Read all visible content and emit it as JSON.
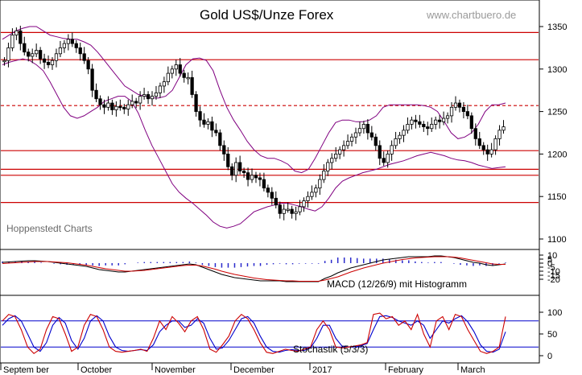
{
  "header": {
    "title": "Gold US$/Unze Forex",
    "site": "www.chartbuero.de"
  },
  "watermark": "Hoppenstedt Charts",
  "colors": {
    "price": "#000000",
    "band": "#800080",
    "resistance": "#cc0000",
    "macd_line": "#000000",
    "macd_signal": "#cc0000",
    "macd_hist": "#2a2acc",
    "stoch_k": "#cc0000",
    "stoch_d": "#0000cc",
    "stoch_levels": "#0000cc"
  },
  "chart_data": [
    {
      "type": "candlestick",
      "title": "Gold US$/Unze Forex",
      "ylim": [
        1100,
        1365
      ],
      "y_ticks": [
        "1100",
        "1150",
        "1200",
        "1250",
        "1300",
        "1350"
      ],
      "x_labels": [
        "Septem ber",
        "October",
        "November",
        "December",
        "2017",
        "February",
        "March"
      ],
      "close": [
        1310,
        1325,
        1340,
        1345,
        1330,
        1320,
        1315,
        1318,
        1322,
        1312,
        1308,
        1305,
        1310,
        1318,
        1325,
        1330,
        1335,
        1330,
        1325,
        1318,
        1310,
        1300,
        1275,
        1265,
        1258,
        1255,
        1260,
        1252,
        1256,
        1255,
        1253,
        1258,
        1262,
        1260,
        1268,
        1270,
        1265,
        1268,
        1272,
        1280,
        1285,
        1295,
        1300,
        1305,
        1295,
        1290,
        1290,
        1270,
        1250,
        1240,
        1235,
        1238,
        1228,
        1225,
        1210,
        1200,
        1185,
        1175,
        1190,
        1180,
        1178,
        1170,
        1175,
        1172,
        1170,
        1160,
        1155,
        1148,
        1140,
        1130,
        1135,
        1135,
        1130,
        1132,
        1138,
        1145,
        1150,
        1155,
        1160,
        1170,
        1180,
        1190,
        1195,
        1200,
        1205,
        1210,
        1215,
        1220,
        1225,
        1230,
        1235,
        1225,
        1220,
        1210,
        1195,
        1190,
        1200,
        1210,
        1218,
        1222,
        1228,
        1235,
        1240,
        1238,
        1235,
        1232,
        1230,
        1235,
        1240,
        1238,
        1242,
        1245,
        1255,
        1260,
        1255,
        1250,
        1245,
        1230,
        1218,
        1210,
        1205,
        1200,
        1205,
        1218,
        1228,
        1232
      ],
      "bollinger_upper": [
        1335,
        1340,
        1345,
        1348,
        1350,
        1350,
        1345,
        1340,
        1338,
        1336,
        1335,
        1335,
        1332,
        1328,
        1320,
        1310,
        1300,
        1290,
        1280,
        1275,
        1270,
        1268,
        1266,
        1266,
        1268,
        1275,
        1290,
        1305,
        1312,
        1313,
        1310,
        1298,
        1275,
        1255,
        1240,
        1228,
        1215,
        1205,
        1198,
        1195,
        1195,
        1192,
        1188,
        1180,
        1178,
        1182,
        1195,
        1210,
        1225,
        1237,
        1240,
        1240,
        1238,
        1238,
        1240,
        1245,
        1255,
        1258,
        1258,
        1258,
        1258,
        1258,
        1257,
        1255,
        1250,
        1238,
        1225,
        1218,
        1220,
        1225,
        1235,
        1250,
        1258,
        1258,
        1260
      ],
      "bollinger_lower": [
        1305,
        1308,
        1310,
        1312,
        1310,
        1305,
        1298,
        1285,
        1270,
        1255,
        1245,
        1242,
        1245,
        1250,
        1255,
        1262,
        1265,
        1268,
        1268,
        1262,
        1248,
        1228,
        1210,
        1195,
        1180,
        1165,
        1155,
        1148,
        1142,
        1135,
        1128,
        1120,
        1115,
        1113,
        1115,
        1118,
        1125,
        1132,
        1135,
        1138,
        1140,
        1142,
        1142,
        1140,
        1138,
        1135,
        1133,
        1138,
        1148,
        1160,
        1168,
        1172,
        1175,
        1178,
        1180,
        1182,
        1185,
        1188,
        1190,
        1192,
        1195,
        1198,
        1200,
        1202,
        1200,
        1198,
        1195,
        1193,
        1192,
        1190,
        1187,
        1185,
        1183,
        1184,
        1185
      ],
      "resistance_lines": [
        1343,
        1311,
        1257,
        1204,
        1182,
        1175,
        1143
      ],
      "resistance_styles": [
        "solid",
        "solid",
        "dashed",
        "solid",
        "solid",
        "solid",
        "solid"
      ]
    },
    {
      "type": "macd",
      "name": "MACD (12/26/9) mit Histogramm",
      "ylim": [
        -24,
        14
      ],
      "y_ticks": [
        "10",
        "5",
        "0",
        "-5",
        "-10",
        "-15",
        "-20"
      ],
      "macd": [
        1,
        1.5,
        2,
        2.5,
        3,
        3,
        2.5,
        2,
        1,
        0,
        -1,
        -2,
        -3,
        -4,
        -6,
        -8,
        -9,
        -10,
        -11,
        -11,
        -10,
        -9,
        -8,
        -7,
        -6,
        -5,
        -4,
        -3,
        -2,
        -1,
        -2,
        -5,
        -8,
        -11,
        -14,
        -16,
        -18,
        -19,
        -20,
        -21,
        -22,
        -22,
        -22,
        -22,
        -23,
        -23,
        -23,
        -23,
        -23,
        -23,
        -19,
        -16,
        -12,
        -9,
        -6,
        -4,
        -2,
        0,
        2,
        4,
        5,
        6,
        7,
        8,
        8,
        8,
        8,
        9,
        9,
        8,
        7,
        5,
        3,
        1,
        0,
        -2,
        -3,
        -2,
        -1
      ],
      "signal": [
        -0.5,
        0,
        0.5,
        1,
        1.5,
        2,
        2,
        2,
        1.5,
        1,
        0.5,
        -0.5,
        -1.5,
        -2.5,
        -4,
        -5.5,
        -7,
        -8,
        -9,
        -10,
        -10,
        -9.5,
        -9,
        -8,
        -7,
        -6,
        -5,
        -4,
        -3,
        -2.5,
        -2.5,
        -3.5,
        -5.5,
        -7.5,
        -10,
        -12,
        -14,
        -15.5,
        -17,
        -18.5,
        -19.5,
        -20.5,
        -21,
        -21.5,
        -22,
        -22,
        -22.5,
        -22.5,
        -22.5,
        -22.5,
        -21,
        -19,
        -17,
        -14,
        -11,
        -8.5,
        -6,
        -4,
        -2,
        0,
        1.5,
        3,
        4.5,
        5.5,
        6.5,
        7,
        7.5,
        8,
        8,
        8,
        7.5,
        6.5,
        5,
        3.5,
        2,
        0.5,
        -1,
        -1.5,
        -1.5
      ]
    },
    {
      "type": "stochastic",
      "name": "Stochastik (5/3/3)",
      "ylim": [
        0,
        100
      ],
      "y_ticks": [
        "100",
        "50",
        "0"
      ],
      "levels": [
        80,
        20
      ],
      "k": [
        80,
        95,
        90,
        60,
        20,
        5,
        15,
        60,
        90,
        85,
        50,
        10,
        20,
        70,
        95,
        90,
        60,
        20,
        10,
        8,
        10,
        12,
        15,
        10,
        40,
        80,
        60,
        90,
        75,
        55,
        80,
        90,
        60,
        15,
        8,
        25,
        45,
        80,
        95,
        85,
        60,
        30,
        8,
        5,
        10,
        15,
        12,
        10,
        15,
        20,
        60,
        80,
        60,
        20,
        18,
        20,
        22,
        25,
        30,
        95,
        98,
        85,
        90,
        70,
        80,
        60,
        95,
        50,
        20,
        80,
        90,
        60,
        95,
        90,
        60,
        35,
        10,
        5,
        10,
        20,
        90
      ],
      "d": [
        70,
        85,
        92,
        80,
        50,
        20,
        10,
        30,
        70,
        88,
        75,
        35,
        15,
        40,
        80,
        92,
        80,
        45,
        20,
        12,
        10,
        12,
        14,
        12,
        25,
        55,
        70,
        80,
        80,
        65,
        70,
        85,
        75,
        40,
        15,
        18,
        35,
        60,
        85,
        90,
        75,
        45,
        20,
        10,
        8,
        12,
        14,
        12,
        12,
        18,
        40,
        70,
        70,
        40,
        22,
        20,
        20,
        23,
        28,
        60,
        90,
        92,
        88,
        80,
        75,
        70,
        80,
        70,
        40,
        60,
        80,
        75,
        85,
        92,
        78,
        55,
        25,
        10,
        8,
        15,
        55
      ]
    }
  ]
}
